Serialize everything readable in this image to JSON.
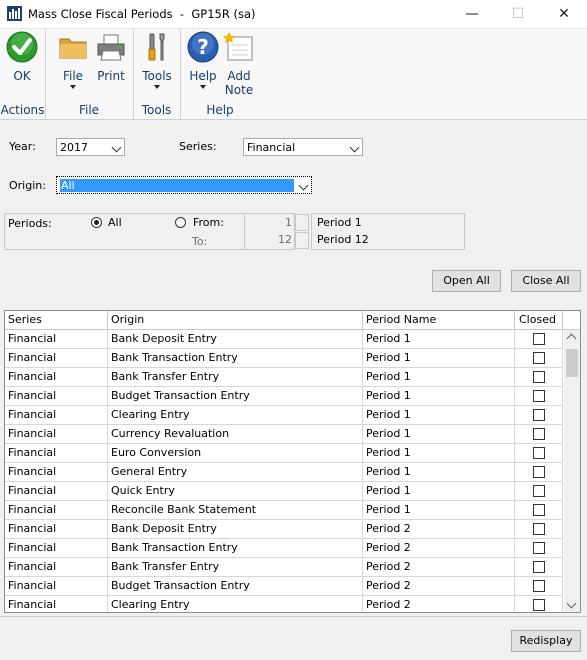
{
  "window": {
    "title": "Mass Close Fiscal Periods  -  GP15R (sa)",
    "minimize_glyph": "—",
    "maximize_glyph": "☐",
    "close_glyph": "✕"
  },
  "ribbon": {
    "groups": {
      "actions": {
        "label": "Actions",
        "ok_label": "OK"
      },
      "file": {
        "label": "File",
        "file_label": "File",
        "print_label": "Print"
      },
      "tools": {
        "label": "Tools",
        "tools_label": "Tools"
      },
      "help": {
        "label": "Help",
        "help_label": "Help",
        "add_note_label": "Add Note"
      }
    },
    "icons": [
      "ok-checkmark-icon",
      "folder-icon",
      "printer-icon",
      "tools-icon",
      "help-icon",
      "add-note-icon"
    ]
  },
  "filters": {
    "year_label": "Year:",
    "year_value": "2017",
    "series_label": "Series:",
    "series_value": "Financial",
    "origin_label": "Origin:",
    "origin_value": "All"
  },
  "periods": {
    "label": "Periods:",
    "all_label": "All",
    "from_label": "From:",
    "to_label": "To:",
    "from_number": "1",
    "from_name": "Period 1",
    "to_number": "12",
    "to_name": "Period 12",
    "selected": "All"
  },
  "buttons": {
    "open_all": "Open All",
    "close_all": "Close All",
    "redisplay": "Redisplay"
  },
  "grid": {
    "headers": [
      "Series",
      "Origin",
      "Period Name",
      "Closed"
    ],
    "rows": [
      {
        "series": "Financial",
        "origin": "Bank Deposit Entry",
        "period": "Period 1",
        "closed": false
      },
      {
        "series": "Financial",
        "origin": "Bank Transaction Entry",
        "period": "Period 1",
        "closed": false
      },
      {
        "series": "Financial",
        "origin": "Bank Transfer Entry",
        "period": "Period 1",
        "closed": false
      },
      {
        "series": "Financial",
        "origin": "Budget Transaction Entry",
        "period": "Period 1",
        "closed": false
      },
      {
        "series": "Financial",
        "origin": "Clearing Entry",
        "period": "Period 1",
        "closed": false
      },
      {
        "series": "Financial",
        "origin": "Currency Revaluation",
        "period": "Period 1",
        "closed": false
      },
      {
        "series": "Financial",
        "origin": "Euro Conversion",
        "period": "Period 1",
        "closed": false
      },
      {
        "series": "Financial",
        "origin": "General Entry",
        "period": "Period 1",
        "closed": false
      },
      {
        "series": "Financial",
        "origin": "Quick Entry",
        "period": "Period 1",
        "closed": false
      },
      {
        "series": "Financial",
        "origin": "Reconcile Bank Statement",
        "period": "Period 1",
        "closed": false
      },
      {
        "series": "Financial",
        "origin": "Bank Deposit Entry",
        "period": "Period 2",
        "closed": false
      },
      {
        "series": "Financial",
        "origin": "Bank Transaction Entry",
        "period": "Period 2",
        "closed": false
      },
      {
        "series": "Financial",
        "origin": "Bank Transfer Entry",
        "period": "Period 2",
        "closed": false
      },
      {
        "series": "Financial",
        "origin": "Budget Transaction Entry",
        "period": "Period 2",
        "closed": false
      },
      {
        "series": "Financial",
        "origin": "Clearing Entry",
        "period": "Period 2",
        "closed": false
      }
    ]
  },
  "colors": {
    "ribbon_label": "#1a3d6e",
    "selection": "#3399ff",
    "ok_green": "#2e9a2e",
    "help_blue": "#2a5fb0"
  }
}
